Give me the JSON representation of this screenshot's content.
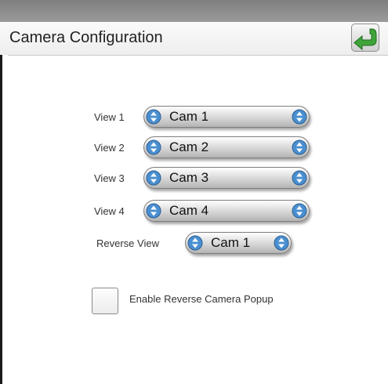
{
  "header": {
    "title": "Camera Configuration",
    "back_icon": "back-arrow-icon"
  },
  "views": [
    {
      "label": "View 1",
      "value": "Cam 1"
    },
    {
      "label": "View 2",
      "value": "Cam 2"
    },
    {
      "label": "View 3",
      "value": "Cam 3"
    },
    {
      "label": "View 4",
      "value": "Cam 4"
    }
  ],
  "reverse_view": {
    "label": "Reverse View",
    "value": "Cam 1"
  },
  "popup_option": {
    "label": "Enable Reverse Camera Popup",
    "checked": false
  },
  "colors": {
    "accent_green": "#3fa33a",
    "spinner_blue": "#4a8fd0",
    "header_strip": "#8c8c8c"
  }
}
